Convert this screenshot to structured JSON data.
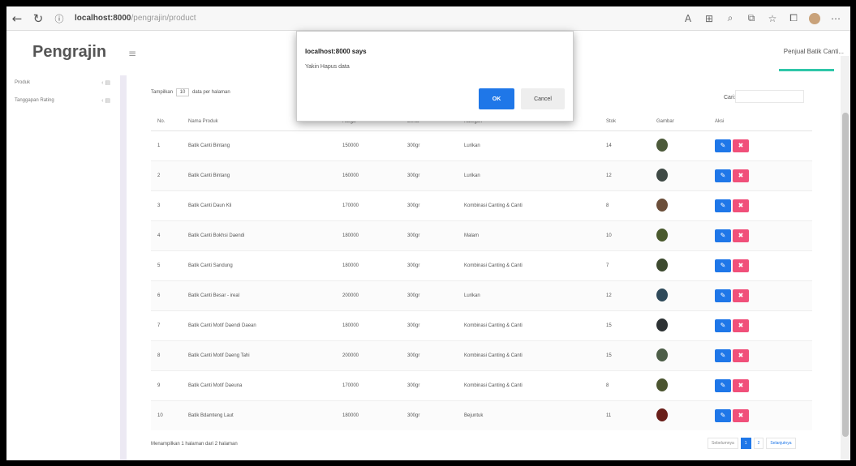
{
  "browser": {
    "url_host": "localhost:8000",
    "url_path": "/pengrajin/product"
  },
  "app": {
    "brand": "Pengrajin",
    "user_menu": "Penjual Batik Canti..."
  },
  "sidebar": {
    "items": [
      {
        "label": "Produk"
      },
      {
        "label": "Tanggapan Rating"
      }
    ]
  },
  "table": {
    "length_prefix": "Tampilkan",
    "length_value": "10",
    "length_suffix": "data per halaman",
    "search_label": "Cari:",
    "headers": [
      "No.",
      "Nama Produk",
      "Harga",
      "Berat",
      "Kategori",
      "Stok",
      "Gambar",
      "Aksi"
    ],
    "rows": [
      {
        "no": "1",
        "name": "Batik Canti Bintang",
        "price": "150000",
        "weight": "300gr",
        "category": "Lurikan",
        "stock": "14",
        "color": "#4c5a3a"
      },
      {
        "no": "2",
        "name": "Batik Canti Bintang",
        "price": "160000",
        "weight": "300gr",
        "category": "Lurikan",
        "stock": "12",
        "color": "#3f4a45"
      },
      {
        "no": "3",
        "name": "Batik Canti Daun Kli",
        "price": "170000",
        "weight": "300gr",
        "category": "Kombinasi Canting & Canti",
        "stock": "8",
        "color": "#6b4e3a"
      },
      {
        "no": "4",
        "name": "Batik Canti Bokhsi Daendi",
        "price": "180000",
        "weight": "300gr",
        "category": "Malam",
        "stock": "10",
        "color": "#4a5a2e"
      },
      {
        "no": "5",
        "name": "Batik Canti Sandung",
        "price": "180000",
        "weight": "300gr",
        "category": "Kombinasi Canting & Canti",
        "stock": "7",
        "color": "#3d4a2f"
      },
      {
        "no": "6",
        "name": "Batik Canti Besar - ireal",
        "price": "200000",
        "weight": "300gr",
        "category": "Lurikan",
        "stock": "12",
        "color": "#2f4a5a"
      },
      {
        "no": "7",
        "name": "Batik Canti Motif Daendi Daean",
        "price": "180000",
        "weight": "300gr",
        "category": "Kombinasi Canting & Canti",
        "stock": "15",
        "color": "#2d3234"
      },
      {
        "no": "8",
        "name": "Batik Canti Motif Daeng Tahi",
        "price": "200000",
        "weight": "300gr",
        "category": "Kombinasi Canting & Canti",
        "stock": "15",
        "color": "#4d5e48"
      },
      {
        "no": "9",
        "name": "Batik Canti Motif Daeuna",
        "price": "170000",
        "weight": "300gr",
        "category": "Kombinasi Canting & Canti",
        "stock": "8",
        "color": "#4b5530"
      },
      {
        "no": "10",
        "name": "Batik Bdamteng Laut",
        "price": "180000",
        "weight": "300gr",
        "category": "Bejuntuk",
        "stock": "11",
        "color": "#6a1f1a"
      }
    ],
    "info": "Menampilkan 1 halaman dari 2 halaman",
    "pager": {
      "prev": "Sebelumnya",
      "page1": "1",
      "page2": "2",
      "next": "Selanjutnya"
    }
  },
  "dialog": {
    "title": "localhost:8000 says",
    "message": "Yakin Hapus data",
    "ok": "OK",
    "cancel": "Cancel"
  }
}
